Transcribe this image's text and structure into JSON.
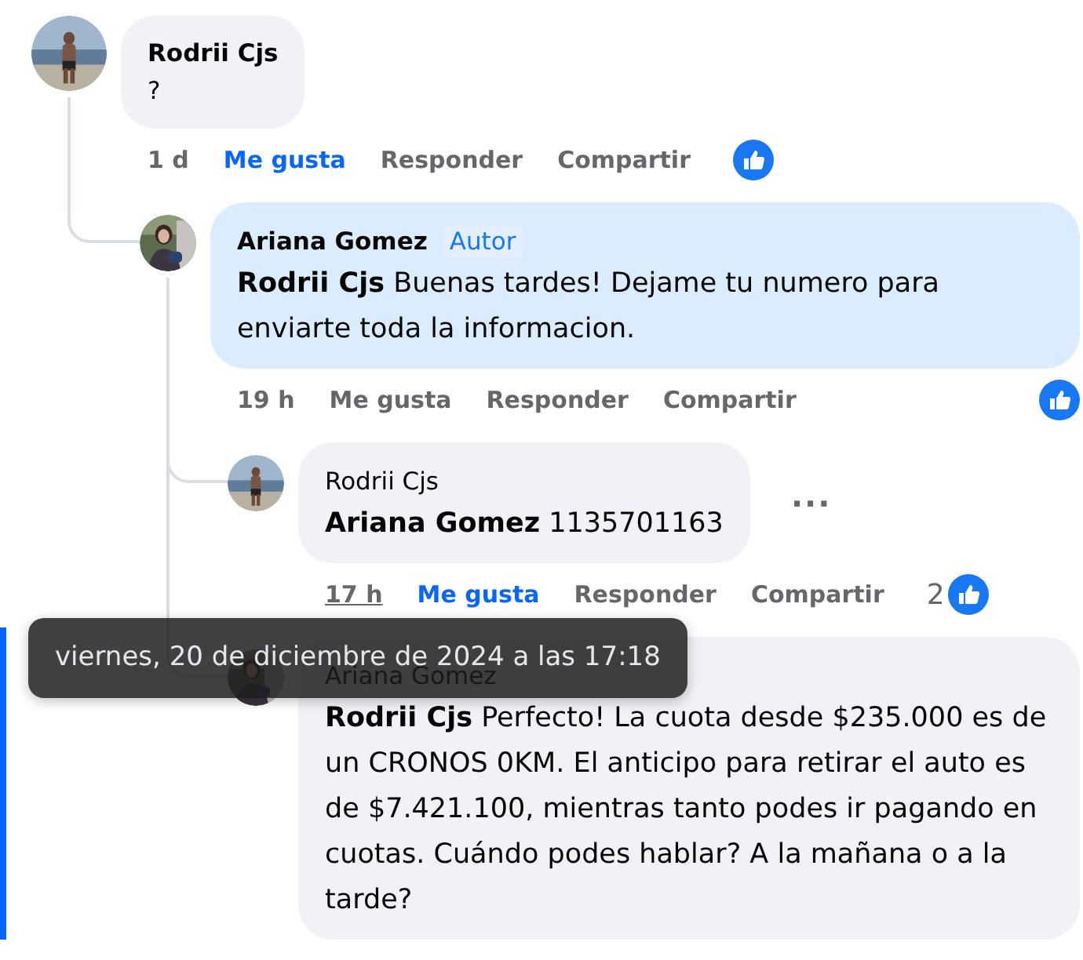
{
  "comments": [
    {
      "author": "Rodrii Cjs",
      "text": "?",
      "highlighted": false,
      "linked": false,
      "time": "1 d",
      "time_hovered": false,
      "like_label": "Me gusta",
      "liked": true,
      "reply_label": "Responder",
      "share_label": "Compartir",
      "children": [
        {
          "author": "Ariana Gomez",
          "author_badge": "Autor",
          "text": "**Rodrii Cjs** Buenas tardes! Dejame tu numero para enviarte toda la informacion.",
          "highlighted": true,
          "linked": false,
          "time": "19 h",
          "time_hovered": false,
          "like_label": "Me gusta",
          "liked": false,
          "reply_label": "Responder",
          "share_label": "Compartir",
          "children": [
            {
              "author": "Rodrii Cjs",
              "text": "**Ariana Gomez** 1135701163",
              "highlighted": false,
              "linked": false,
              "menu_button": "···",
              "time": "17 h",
              "time_hovered": true,
              "like_label": "Me gusta",
              "liked": true,
              "reply_label": "Responder",
              "share_label": "Compartir",
              "reaction_count": "2"
            },
            {
              "author": "Ariana Gomez",
              "text": "**Rodrii Cjs** Perfecto! La cuota desde $235.000 es de un CRONOS 0KM. El anticipo para retirar el auto es de $7.421.100, mientras tanto podes ir pagando en cuotas. Cuándo podes hablar? A la mañana o a la tarde?",
              "highlighted": false,
              "linked": true
            }
          ]
        }
      ]
    }
  ],
  "tooltip": {
    "text": "viernes, 20 de diciembre de 2024 a las 17:18"
  }
}
